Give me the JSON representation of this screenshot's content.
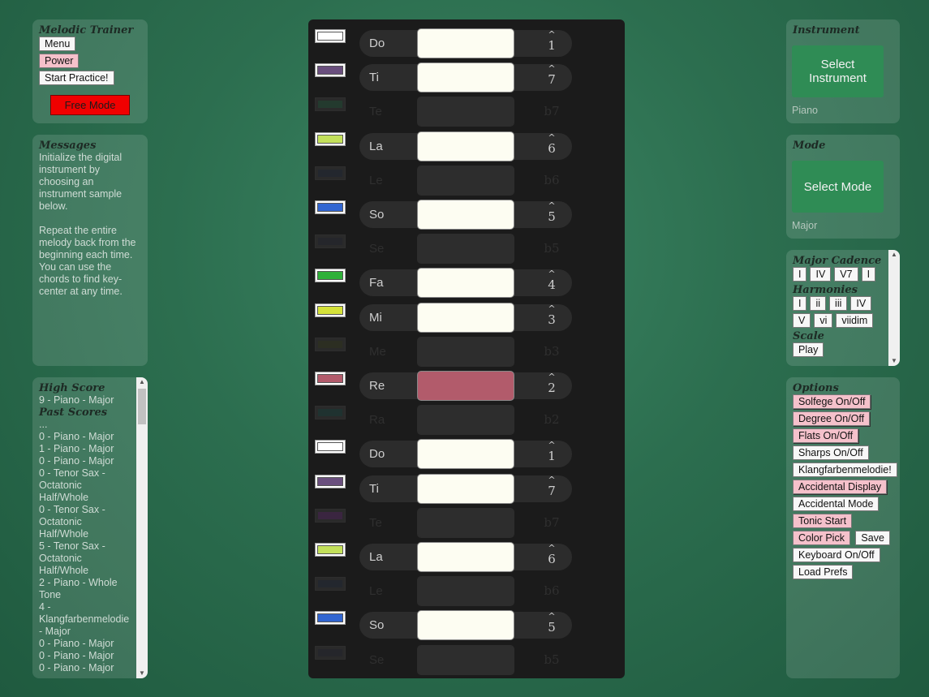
{
  "trainer": {
    "title": "Melodic Trainer",
    "menu": "Menu",
    "power": "Power",
    "start": "Start Practice!",
    "free_mode": "Free Mode"
  },
  "messages": {
    "title": "Messages",
    "line1": "Initialize the digital instrument by choosing an instrument sample below.",
    "line2": "Repeat the entire melody back from the beginning each time. You can use the chords to find key-center at any time."
  },
  "scores": {
    "high_title": "High Score",
    "high_value": "9 - Piano - Major",
    "past_title": "Past Scores",
    "entries": [
      "...",
      "0 - Piano - Major",
      "1 - Piano - Major",
      "0 - Piano - Major",
      "0 - Tenor Sax - Octatonic Half/Whole",
      "0 - Tenor Sax - Octatonic Half/Whole",
      "5 - Tenor Sax - Octatonic Half/Whole",
      "2 - Piano - Whole Tone",
      "4 - Klangfarbenmelodie - Major",
      "0 - Piano - Major",
      "0 - Piano - Major",
      "0 - Piano - Major"
    ]
  },
  "instrument": {
    "title": "Instrument",
    "button": "Select Instrument",
    "value": "Piano"
  },
  "mode": {
    "title": "Mode",
    "button": "Select Mode",
    "value": "Major"
  },
  "chords": {
    "cadence_title": "Major Cadence",
    "cadence": [
      "I",
      "IV",
      "V7",
      "I"
    ],
    "harmonies_title": "Harmonies",
    "harmonies": [
      "I",
      "ii",
      "iii",
      "IV",
      "V",
      "vi",
      "viidim"
    ],
    "scale_title": "Scale",
    "scale_button": "Play"
  },
  "options": {
    "title": "Options",
    "solfege": "Solfege On/Off",
    "degree": "Degree On/Off",
    "flats": "Flats On/Off",
    "sharps": "Sharps On/Off",
    "klang": "Klangfarbenmelodie!",
    "acc_display": "Accidental Display",
    "acc_mode": "Accidental Mode",
    "tonic": "Tonic Start",
    "color": "Color Pick",
    "save": "Save",
    "keyboard": "Keyboard On/Off",
    "load": "Load Prefs"
  },
  "keys": [
    {
      "solfege": "Do",
      "degree": "1",
      "color": "#ffffff",
      "active": true,
      "key_color": "#fdfdf2"
    },
    {
      "solfege": "Ti",
      "degree": "7",
      "color": "#6a4f7e",
      "active": true,
      "key_color": "#fdfdf2"
    },
    {
      "solfege": "Te",
      "degree": "b7",
      "color": "#233a2e",
      "active": false
    },
    {
      "solfege": "La",
      "degree": "6",
      "color": "#c3e05b",
      "active": true,
      "key_color": "#fdfdf2"
    },
    {
      "solfege": "Le",
      "degree": "b6",
      "color": "#23272e",
      "active": false
    },
    {
      "solfege": "So",
      "degree": "5",
      "color": "#3266d1",
      "active": true,
      "key_color": "#fdfdf2"
    },
    {
      "solfege": "Se",
      "degree": "b5",
      "color": "#25262b",
      "active": false
    },
    {
      "solfege": "Fa",
      "degree": "4",
      "color": "#2fb039",
      "active": true,
      "key_color": "#fdfdf2"
    },
    {
      "solfege": "Mi",
      "degree": "3",
      "color": "#d5e23a",
      "active": true,
      "key_color": "#fdfdf2"
    },
    {
      "solfege": "Me",
      "degree": "b3",
      "color": "#2c2e22",
      "active": false
    },
    {
      "solfege": "Re",
      "degree": "2",
      "color": "#b25b6b",
      "active": true,
      "key_color": "#b25b6b"
    },
    {
      "solfege": "Ra",
      "degree": "b2",
      "color": "#1f3230",
      "active": false
    },
    {
      "solfege": "Do",
      "degree": "1",
      "color": "#ffffff",
      "active": true,
      "key_color": "#fdfdf2"
    },
    {
      "solfege": "Ti",
      "degree": "7",
      "color": "#6a4f7e",
      "active": true,
      "key_color": "#fdfdf2"
    },
    {
      "solfege": "Te",
      "degree": "b7",
      "color": "#3a2540",
      "active": false
    },
    {
      "solfege": "La",
      "degree": "6",
      "color": "#c3e05b",
      "active": true,
      "key_color": "#fdfdf2"
    },
    {
      "solfege": "Le",
      "degree": "b6",
      "color": "#23272e",
      "active": false
    },
    {
      "solfege": "So",
      "degree": "5",
      "color": "#3266d1",
      "active": true,
      "key_color": "#fdfdf2"
    },
    {
      "solfege": "Se",
      "degree": "b5",
      "color": "#25262b",
      "active": false
    }
  ]
}
